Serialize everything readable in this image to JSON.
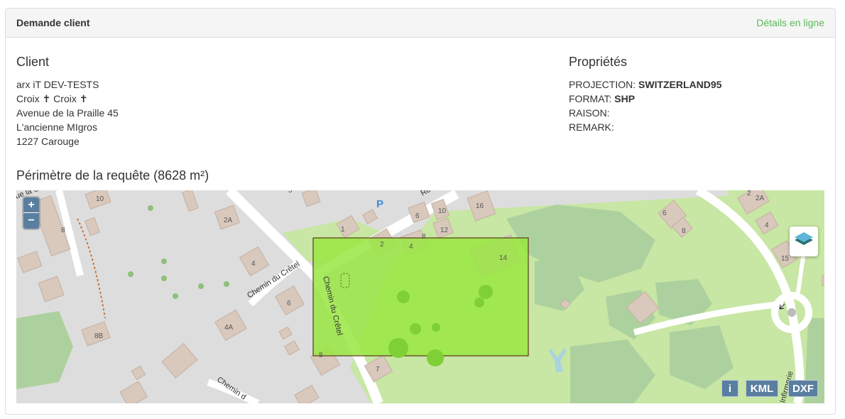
{
  "panel": {
    "title": "Demande client",
    "details_link": "Détails en ligne"
  },
  "client": {
    "heading": "Client",
    "lines": [
      "arx iT DEV-TESTS",
      "Croix ✝ Croix ✝",
      "Avenue de la Praille 45",
      "L'ancienne MIgros",
      "1227 Carouge"
    ]
  },
  "properties": {
    "heading": "Propriétés",
    "items": [
      {
        "label": "PROJECTION:",
        "value": "SWITZERLAND95"
      },
      {
        "label": "FORMAT:",
        "value": "SHP"
      },
      {
        "label": "RAISON:",
        "value": ""
      },
      {
        "label": "REMARK:",
        "value": ""
      }
    ]
  },
  "perimeter": {
    "heading": "Périmètre de la requête (8628 m²)"
  },
  "map": {
    "zoom_in": "+",
    "zoom_out": "−",
    "info_button": "i",
    "kml_button": "KML",
    "dxf_button": "DXF",
    "parking_label": "P",
    "street_labels": {
      "chemin_cretel_1": "Chemin du Crêtel",
      "chemin_cretel_2": "Chemin du Crêtel",
      "chemin_cretel_3": "Chemin d",
      "rue_top": "Ro",
      "infirmerie": "Infirmerie",
      "top_left": "ue la Se"
    },
    "house_numbers": [
      "10",
      "8",
      "2A",
      "4",
      "6",
      "4A",
      "8B",
      "5",
      "1",
      "2",
      "4",
      "8",
      "6",
      "10",
      "12",
      "16",
      "14",
      "7",
      "8",
      "6",
      "8",
      "2",
      "2A",
      "4",
      "15"
    ],
    "colors": {
      "background": "#dddddd",
      "park": "#c8e6a4",
      "wood": "#add19e",
      "building": "#d9c8bc",
      "road": "#ffffff",
      "selection_fill": "#99e642",
      "selection_stroke": "#5b3a1a",
      "button": "#5a7ea0",
      "link": "#5cb85c"
    }
  }
}
